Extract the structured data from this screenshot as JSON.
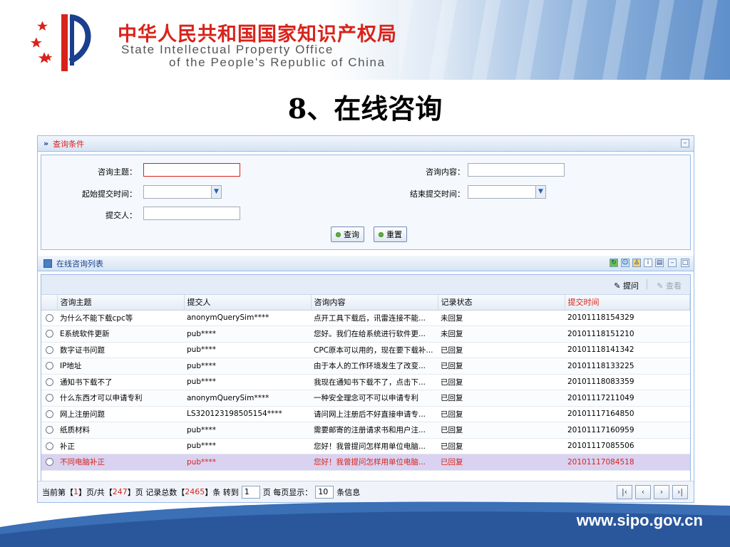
{
  "header": {
    "org_cn": "中华人民共和国国家知识产权局",
    "org_en_line1": "State Intellectual Property Office",
    "org_en_line2": "of the People's Republic of China",
    "logo": "sipo-logo"
  },
  "slide_title": "8、在线咨询",
  "query_panel": {
    "title": "查询条件",
    "fields": {
      "subject_label": "咨询主题：",
      "content_label": "咨询内容：",
      "start_label": "起始提交时间：",
      "end_label": "结束提交时间：",
      "submitter_label": "提交人："
    },
    "search_button": "查询",
    "reset_button": "重置"
  },
  "list_panel": {
    "title": "在线咨询列表",
    "toolbar": {
      "ask": "提问",
      "view": "查看"
    },
    "columns": [
      "咨询主题",
      "提交人",
      "咨询内容",
      "记录状态",
      "提交时间"
    ],
    "rows": [
      [
        "为什么不能下载cpc等",
        "anonymQuerySim****",
        "点开工具下载后，讯雷连接不能...",
        "未回复",
        "20101118154329"
      ],
      [
        "E系统软件更新",
        "pub****",
        "您好。我们在给系统进行软件更...",
        "未回复",
        "20101118151210"
      ],
      [
        "数字证书问题",
        "pub****",
        "CPC原本可以用的，现在要下载补...",
        "已回复",
        "20101118141342"
      ],
      [
        "IP地址",
        "pub****",
        "由于本人的工作环境发生了改变...",
        "已回复",
        "20101118133225"
      ],
      [
        "通知书下载不了",
        "pub****",
        "我现在通知书下载不了，点击下...",
        "已回复",
        "20101118083359"
      ],
      [
        "什么东西才可以申请专利",
        "anonymQuerySim****",
        "一种安全理念可不可以申请专利",
        "已回复",
        "20101117211049"
      ],
      [
        "网上注册问题",
        "LS320123198505154****",
        "请问网上注册后不好直接申请专...",
        "已回复",
        "20101117164850"
      ],
      [
        "纸质材料",
        "pub****",
        "需要邮寄的注册请求书和用户注...",
        "已回复",
        "20101117160959"
      ],
      [
        "补正",
        "pub****",
        "您好！我曾提问怎样用单位电脑...",
        "已回复",
        "20101117085506"
      ],
      [
        "不同电脑补正",
        "pub****",
        "您好！我曾提问怎样用单位电脑...",
        "已回复",
        "20101117084518"
      ]
    ],
    "pager": {
      "prefix": "当前第【",
      "current": "1",
      "mid1": "】页/共【",
      "total_pages": "247",
      "mid2": "】页 记录总数【",
      "total_records": "2465",
      "mid3": "】条 转到",
      "goto_value": "1",
      "mid4": "页 每页显示：",
      "per_page": "10",
      "suffix": "条信息"
    }
  },
  "footer": {
    "url": "www.sipo.gov.cn"
  },
  "colors": {
    "accent_red": "#d8231b",
    "panel_blue": "#99bbe8",
    "selected_row": "#d9d2f0"
  }
}
